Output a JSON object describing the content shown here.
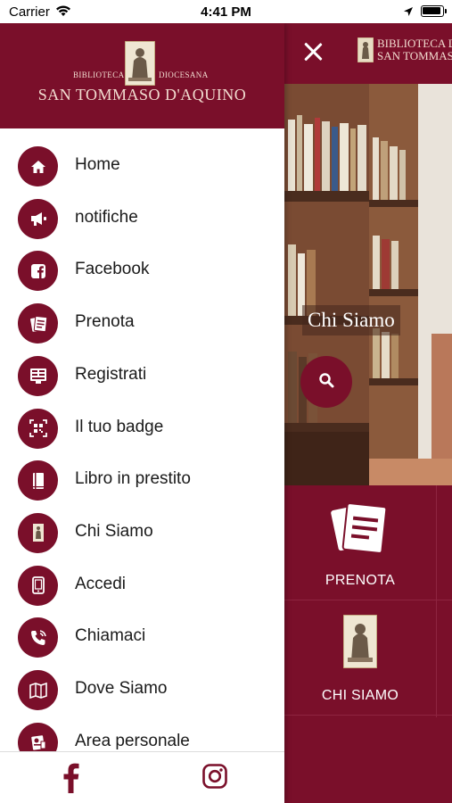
{
  "status_bar": {
    "carrier": "Carrier",
    "time": "4:41 PM"
  },
  "drawer": {
    "header": {
      "small_left": "BIBLIOTECA",
      "small_right": "DIOCESANA",
      "title": "SAN TOMMASO D'AQUINO"
    },
    "menu": [
      {
        "label": "Home",
        "icon": "home-icon"
      },
      {
        "label": "notifiche",
        "icon": "megaphone-icon"
      },
      {
        "label": "Facebook",
        "icon": "facebook-icon"
      },
      {
        "label": "Prenota",
        "icon": "booking-icon"
      },
      {
        "label": "Registrati",
        "icon": "register-icon"
      },
      {
        "label": "Il tuo badge",
        "icon": "badge-icon"
      },
      {
        "label": "Libro in prestito",
        "icon": "book-icon"
      },
      {
        "label": "Chi Siamo",
        "icon": "about-icon"
      },
      {
        "label": "Accedi",
        "icon": "login-icon"
      },
      {
        "label": "Chiamaci",
        "icon": "phone-icon"
      },
      {
        "label": "Dove Siamo",
        "icon": "map-icon"
      },
      {
        "label": "Area personale",
        "icon": "personal-area-icon"
      }
    ],
    "footer": {
      "facebook_icon": "facebook-icon",
      "instagram_icon": "instagram-icon"
    }
  },
  "main": {
    "header_brand_line1": "BIBLIOTECA D",
    "header_brand_line2": "SAN TOMMASO",
    "hero_title": "Chi Siamo",
    "tiles": [
      {
        "label": "PRENOTA",
        "icon": "booking-icon"
      },
      {
        "label": "CHI SIAMO",
        "icon": "about-icon"
      }
    ]
  },
  "colors": {
    "brand": "#7a0f2a",
    "header_text": "#f2dcd0"
  }
}
